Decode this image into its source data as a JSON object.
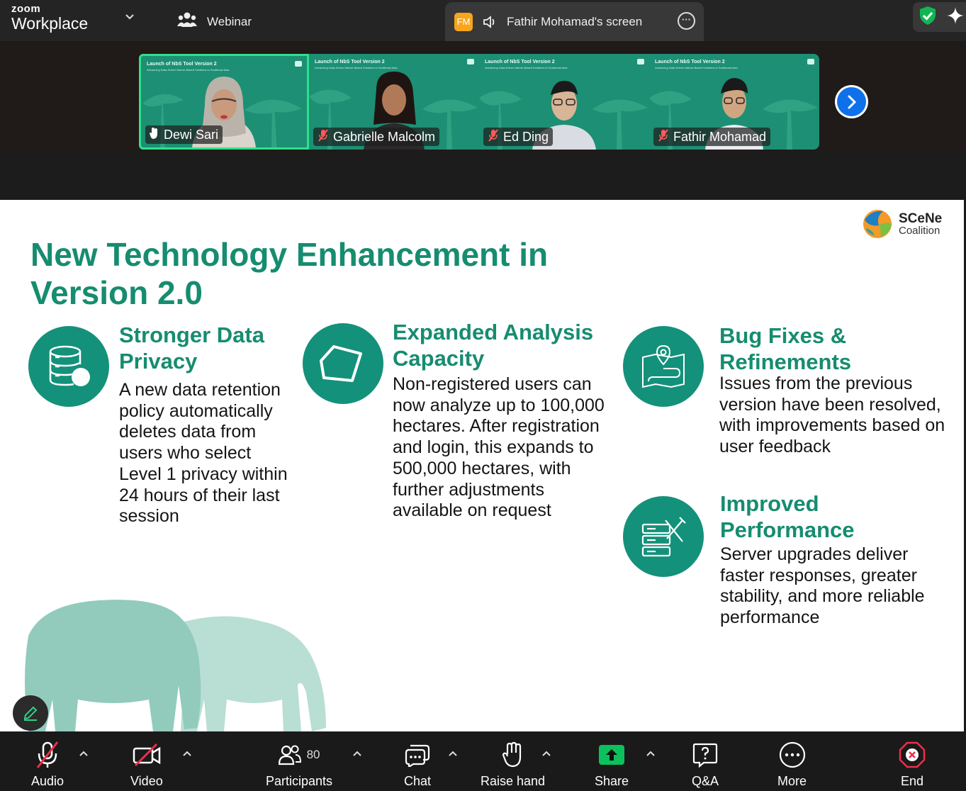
{
  "titlebar": {
    "brand_small": "zoom",
    "brand_large": "Workplace",
    "webinar_label": "Webinar",
    "sharer_initials": "FM",
    "screen_label": "Fathir Mohamad's screen"
  },
  "gallery": {
    "tile_title": "Launch of NbS Tool Version 2",
    "tile_subtitle": "Advancing Data-Driven Nature-Based Solutions in Southeast Asia",
    "participants": [
      {
        "name": "Dewi Sari",
        "status": "active-speaker"
      },
      {
        "name": "Gabrielle Malcolm",
        "status": "muted"
      },
      {
        "name": "Ed Ding",
        "status": "muted"
      },
      {
        "name": "Fathir Mohamad",
        "status": "muted"
      }
    ]
  },
  "slide": {
    "title": "New Technology Enhancement  in Version 2.0",
    "logo_line1": "SCeNe",
    "logo_line2": "Coalition",
    "features": [
      {
        "heading": "Stronger Data Privacy",
        "icon": "database-icon",
        "body": "A new data retention policy automatically deletes data from users who select Level 1 privacy within 24 hours of their last session"
      },
      {
        "heading": "Expanded Analysis Capacity",
        "icon": "polygon-icon",
        "body": "Non-registered users can now analyze up to 100,000 hectares. After registration and login, this expands to 500,000 hectares, with further adjustments available on request"
      },
      {
        "heading": "Bug Fixes & Refinements",
        "icon": "map-pin-route-icon",
        "body": "Issues from the previous version have been resolved, with improvements based on user feedback"
      },
      {
        "heading": "Improved Performance",
        "icon": "server-tools-icon",
        "body": "Server upgrades deliver faster responses, greater stability, and more reliable performance"
      }
    ]
  },
  "toolbar": {
    "audio": "Audio",
    "video": "Video",
    "participants": "Participants",
    "participant_count": "80",
    "chat": "Chat",
    "raise_hand": "Raise hand",
    "share": "Share",
    "qa": "Q&A",
    "more": "More",
    "end": "End"
  },
  "colors": {
    "slide_green": "#168c70",
    "tile_green": "#1c8f74",
    "active_border": "#2fe08a",
    "share_green": "#0bc15c",
    "end_red": "#ee2e4a",
    "next_blue": "#0e71eb"
  }
}
